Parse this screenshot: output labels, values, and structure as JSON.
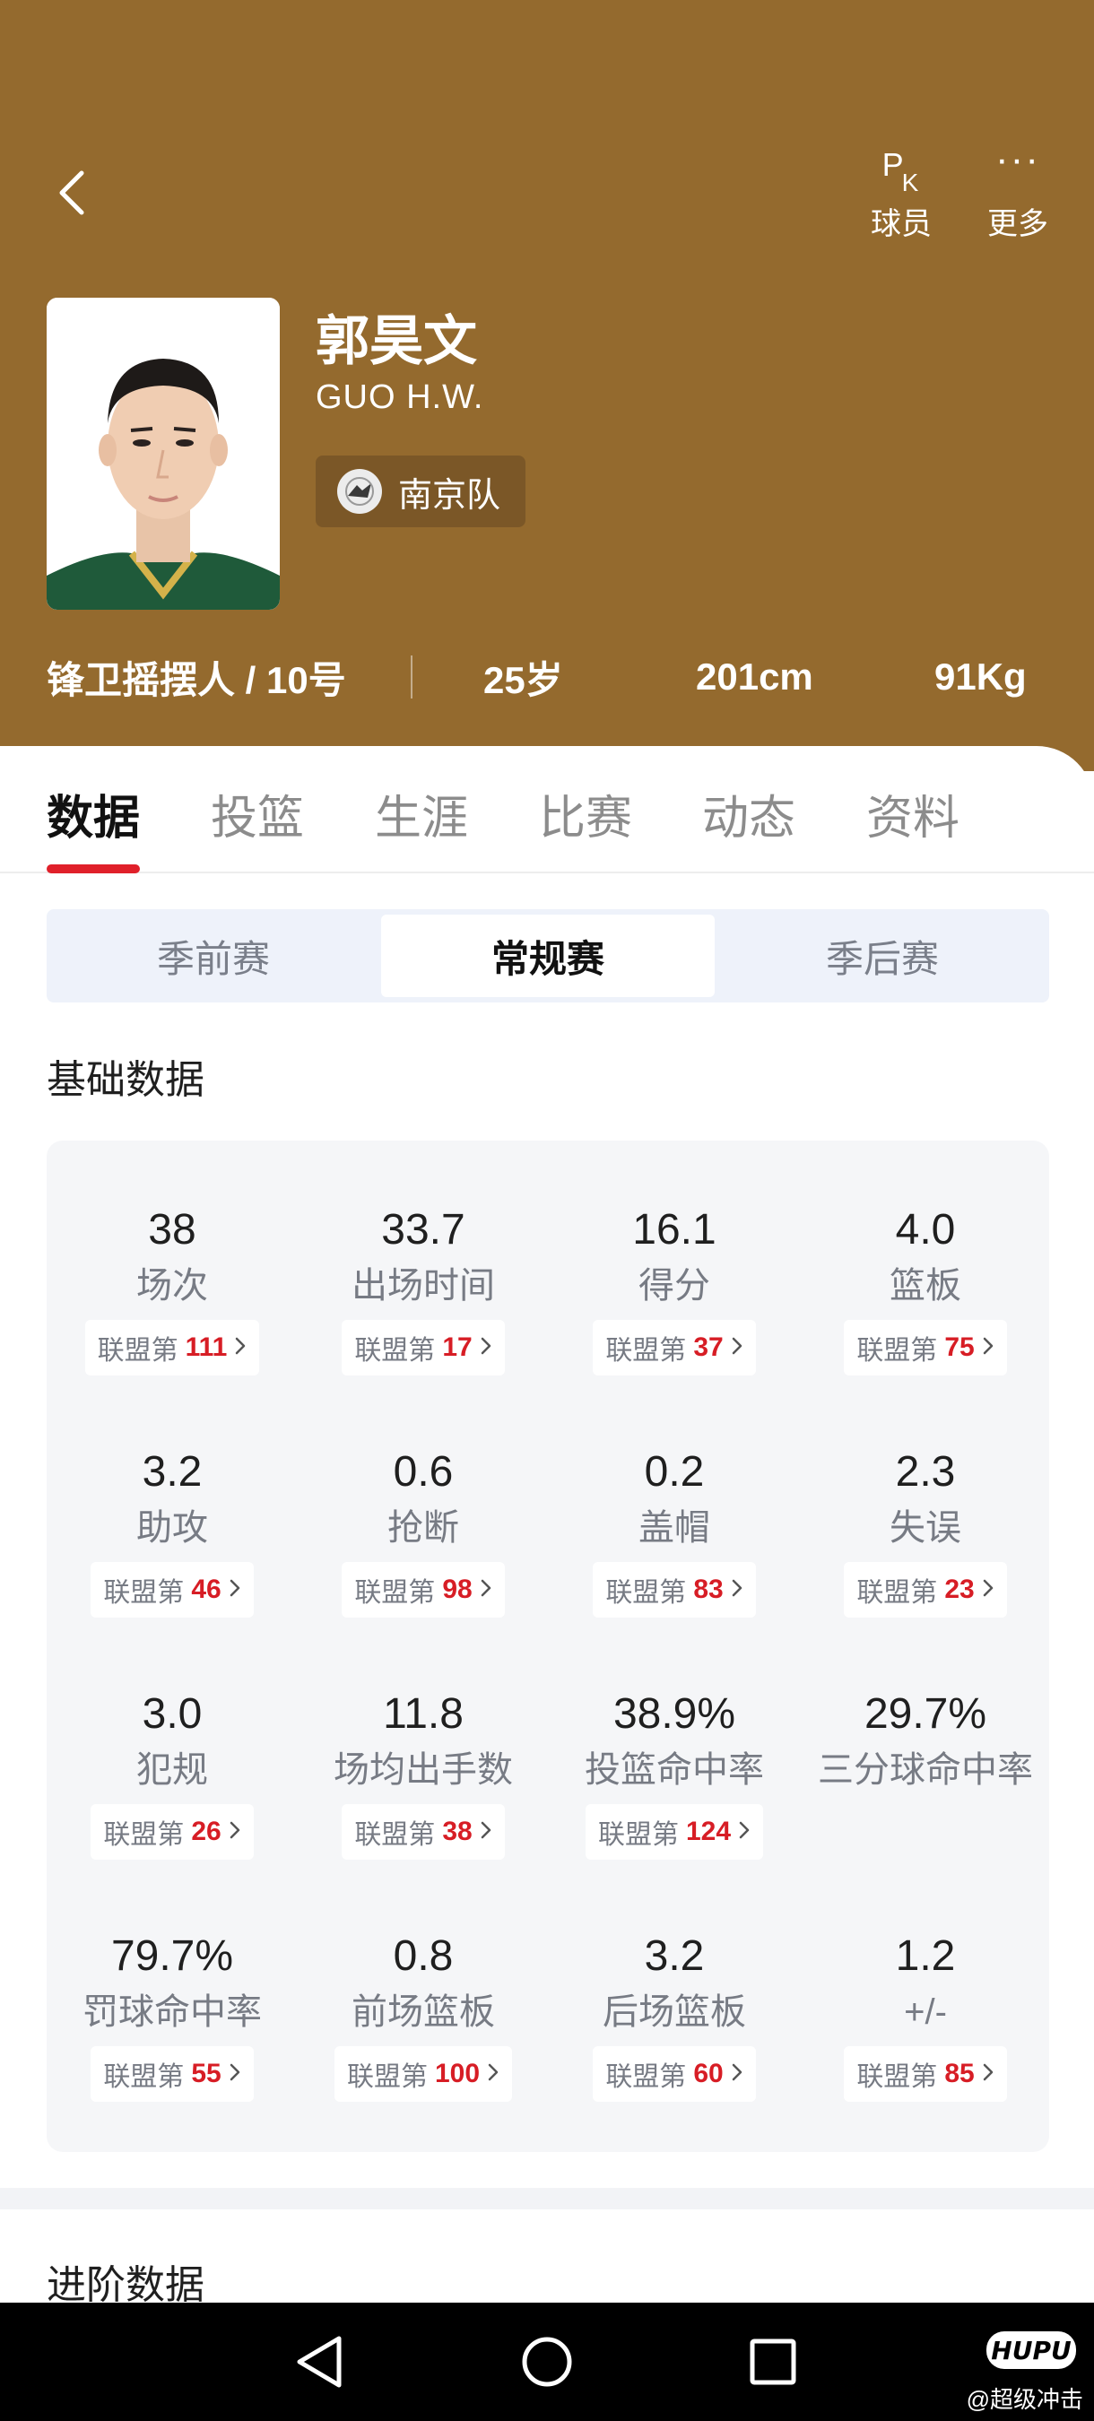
{
  "header": {
    "actions": [
      {
        "icon": "pk-icon",
        "label": "球员",
        "icon_text": "P",
        "icon_sub": "K"
      },
      {
        "icon": "more-icon",
        "label": "更多",
        "icon_text": "···"
      }
    ],
    "bg_color": "#946a2e"
  },
  "player": {
    "name_cn": "郭昊文",
    "name_en": "GUO H.W.",
    "team": "南京队",
    "position_number": "锋卫摇摆人 / 10号",
    "age": "25岁",
    "height": "201cm",
    "weight": "91Kg"
  },
  "tabs": [
    "数据",
    "投篮",
    "生涯",
    "比赛",
    "动态",
    "资料"
  ],
  "active_tab": "数据",
  "season_types": [
    "季前赛",
    "常规赛",
    "季后赛"
  ],
  "active_season_type": "常规赛",
  "sections": {
    "basic": "基础数据",
    "advanced": "进阶数据"
  },
  "rank_prefix": "联盟第",
  "stats": [
    {
      "value": "38",
      "label": "场次",
      "rank": "111"
    },
    {
      "value": "33.7",
      "label": "出场时间",
      "rank": "17"
    },
    {
      "value": "16.1",
      "label": "得分",
      "rank": "37"
    },
    {
      "value": "4.0",
      "label": "篮板",
      "rank": "75"
    },
    {
      "value": "3.2",
      "label": "助攻",
      "rank": "46"
    },
    {
      "value": "0.6",
      "label": "抢断",
      "rank": "98"
    },
    {
      "value": "0.2",
      "label": "盖帽",
      "rank": "83"
    },
    {
      "value": "2.3",
      "label": "失误",
      "rank": "23"
    },
    {
      "value": "3.0",
      "label": "犯规",
      "rank": "26"
    },
    {
      "value": "11.8",
      "label": "场均出手数",
      "rank": "38"
    },
    {
      "value": "38.9%",
      "label": "投篮命中率",
      "rank": "124"
    },
    {
      "value": "29.7%",
      "label": "三分球命中率",
      "rank": null
    },
    {
      "value": "79.7%",
      "label": "罚球命中率",
      "rank": "55"
    },
    {
      "value": "0.8",
      "label": "前场篮板",
      "rank": "100"
    },
    {
      "value": "3.2",
      "label": "后场篮板",
      "rank": "60"
    },
    {
      "value": "1.2",
      "label": "+/-",
      "rank": "85"
    }
  ],
  "watermark": {
    "logo": "HUPU",
    "text": "@超级冲击"
  },
  "colors": {
    "accent_red": "#e0202a",
    "rank_red": "#d71d25"
  }
}
